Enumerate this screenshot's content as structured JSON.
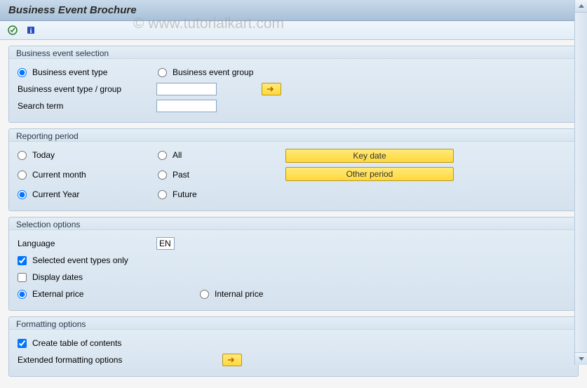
{
  "title": "Business Event Brochure",
  "watermark": "© www.tutorialkart.com",
  "groups": {
    "selection": {
      "title": "Business event selection",
      "radio_type": "Business event type",
      "radio_group": "Business event group",
      "type_group_label": "Business event type / group",
      "search_label": "Search term"
    },
    "period": {
      "title": "Reporting period",
      "today": "Today",
      "all": "All",
      "current_month": "Current month",
      "past": "Past",
      "current_year": "Current Year",
      "future": "Future",
      "key_date_btn": "Key date",
      "other_period_btn": "Other period"
    },
    "options": {
      "title": "Selection options",
      "language_label": "Language",
      "language_value": "EN",
      "selected_only": "Selected event types only",
      "display_dates": "Display dates",
      "external_price": "External price",
      "internal_price": "Internal price"
    },
    "formatting": {
      "title": "Formatting options",
      "toc": "Create table of contents",
      "extended": "Extended formatting options"
    }
  }
}
